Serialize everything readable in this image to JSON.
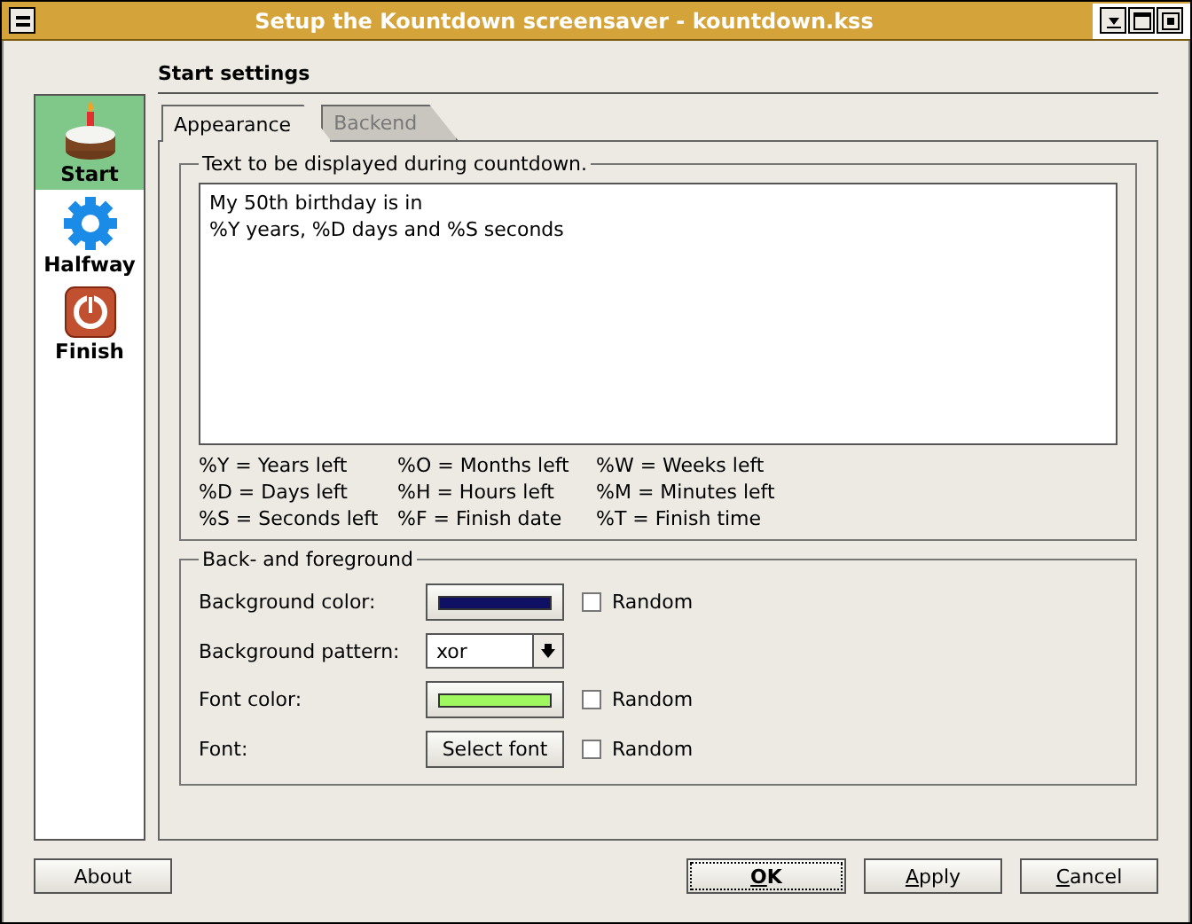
{
  "window": {
    "title": "Setup the Kountdown screensaver - kountdown.kss",
    "buttons": [
      {
        "kind": "menu"
      },
      {
        "kind": "minimize"
      },
      {
        "kind": "maximize"
      },
      {
        "kind": "close"
      }
    ]
  },
  "sidebar": {
    "items": [
      {
        "label": "Start",
        "kind": "cake",
        "selected": true
      },
      {
        "label": "Halfway",
        "kind": "gear",
        "selected": false
      },
      {
        "label": "Finish",
        "kind": "power",
        "selected": false
      }
    ]
  },
  "page_title": "Start settings",
  "tabs": [
    {
      "label": "Appearance",
      "selected": true
    },
    {
      "label": "Backend",
      "selected": false
    }
  ],
  "text_group": {
    "title": "Text to be displayed during countdown.",
    "value": "My 50th birthday is in\n%Y years, %D days and %S seconds",
    "legend": [
      [
        "%Y = Years left",
        "%O = Months left",
        "%W = Weeks left"
      ],
      [
        "%D = Days left",
        "%H = Hours left",
        "%M = Minutes left"
      ],
      [
        "%S = Seconds left",
        "%F = Finish date",
        "%T = Finish time"
      ]
    ]
  },
  "colors_group": {
    "title": "Back- and foreground",
    "rows": [
      {
        "label": "Background color:",
        "kind": "color",
        "color": "#0f0f64",
        "random_label": "Random",
        "random_checked": false
      },
      {
        "label": "Background pattern:",
        "kind": "select",
        "value": "xor"
      },
      {
        "label": "Font color:",
        "kind": "color",
        "color": "#a0f860",
        "random_label": "Random",
        "random_checked": false
      },
      {
        "label": "Font:",
        "kind": "button",
        "value": "Select font",
        "random_label": "Random",
        "random_checked": false
      }
    ]
  },
  "buttons": [
    {
      "label": "About",
      "mnemonic": false,
      "default": false
    },
    {
      "label": "OK",
      "mnemonic": true,
      "default": true
    },
    {
      "label": "Apply",
      "mnemonic": true,
      "default": false
    },
    {
      "label": "Cancel",
      "mnemonic": true,
      "default": false
    }
  ]
}
